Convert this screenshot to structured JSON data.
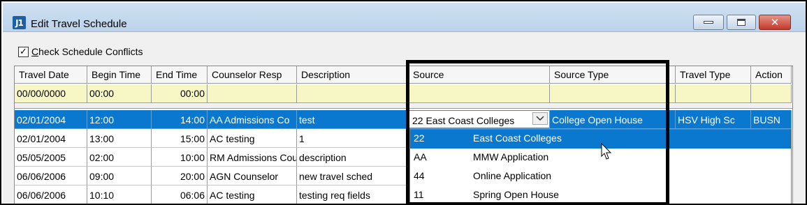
{
  "window": {
    "title": "Edit Travel Schedule",
    "app_icon": "J1"
  },
  "controls": {
    "minimize": "minimize-icon",
    "maximize": "maximize-icon",
    "close": "close-icon"
  },
  "options": {
    "check_conflicts_label_underlined": "C",
    "check_conflicts_label_rest": "heck Schedule Conflicts",
    "check_conflicts_checked": "✓"
  },
  "grid": {
    "columns": [
      "Travel Date",
      "Begin Time",
      "End Time",
      "Counselor Resp",
      "Description",
      "Source",
      "Source Type",
      "Travel Type",
      "Action"
    ],
    "filter_row": {
      "travel_date": "00/00/0000",
      "begin_time": "00:00",
      "end_time": "00:00"
    },
    "rows": [
      {
        "travel_date": "02/01/2004",
        "begin_time": "12:00",
        "end_time": "14:00",
        "counselor": "AA   Admissions Co",
        "description": "test",
        "source": "22  East Coast Colleges",
        "source_type": "College Open House",
        "travel_type": "HSV   High Sc",
        "action": "BUSN"
      },
      {
        "travel_date": "02/01/2004",
        "begin_time": "13:00",
        "end_time": "15:00",
        "counselor": "AC   testing",
        "description": "1"
      },
      {
        "travel_date": "05/05/2005",
        "begin_time": "02:00",
        "end_time": "10:00",
        "counselor": "RM   Admissions Cou",
        "description": "description"
      },
      {
        "travel_date": "06/06/2006",
        "begin_time": "09:00",
        "end_time": "20:00",
        "counselor": "AGN   Counselor",
        "description": "new travel sched"
      },
      {
        "travel_date": "06/06/2006",
        "begin_time": "10:10",
        "end_time": "06:06",
        "counselor": "AC   testing",
        "description": "testing req fields"
      }
    ]
  },
  "source_dropdown": {
    "options": [
      {
        "code": "22",
        "name": "East Coast Colleges",
        "selected": true
      },
      {
        "code": "AA",
        "name": "MMW Application"
      },
      {
        "code": "44",
        "name": "Online Application"
      },
      {
        "code": "11",
        "name": "Spring Open House"
      }
    ]
  },
  "colors": {
    "selection": "#0b78d0",
    "filter_row": "#f7f7c6",
    "titlebar": "#cfe0f1"
  }
}
